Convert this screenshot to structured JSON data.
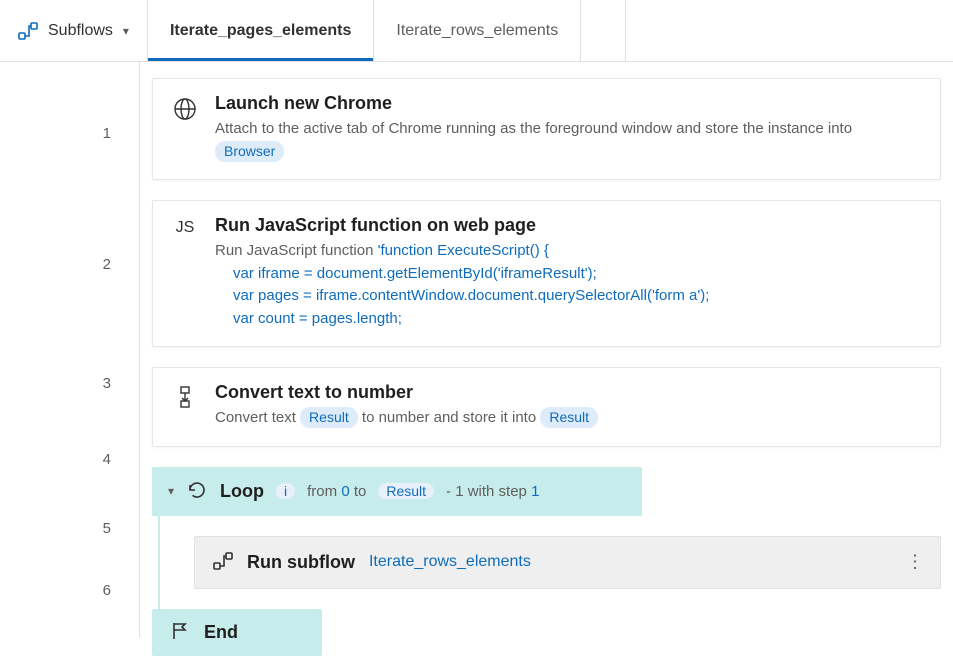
{
  "header": {
    "subflows_label": "Subflows"
  },
  "tabs": [
    {
      "label": "Iterate_pages_elements",
      "active": true
    },
    {
      "label": "Iterate_rows_elements",
      "active": false
    }
  ],
  "lines": [
    "1",
    "2",
    "3",
    "4",
    "5",
    "6"
  ],
  "action1": {
    "title": "Launch new Chrome",
    "desc_pre": "Attach to the active tab of Chrome running as the foreground window and store the instance into ",
    "var": "Browser"
  },
  "action2": {
    "title": "Run JavaScript function on web page",
    "desc_pre": "Run JavaScript function ",
    "code_head": "'function ExecuteScript() {",
    "code_line1": "var iframe = document.getElementById('iframeResult');",
    "code_line2": "var pages = iframe.contentWindow.document.querySelectorAll('form  a');",
    "code_line3": "var count = pages.length;"
  },
  "action3": {
    "title": "Convert text to number",
    "desc_pre": "Convert text ",
    "var1": "Result",
    "desc_mid": " to number and store it into ",
    "var2": "Result"
  },
  "loop": {
    "title": "Loop",
    "iter_var": "i",
    "from_label": "from",
    "from_value": "0",
    "to_label": "to",
    "to_var": "Result",
    "suffix": "- 1 with step",
    "step": "1"
  },
  "subflow_action": {
    "title": "Run subflow",
    "link": "Iterate_rows_elements"
  },
  "end": {
    "label": "End"
  }
}
